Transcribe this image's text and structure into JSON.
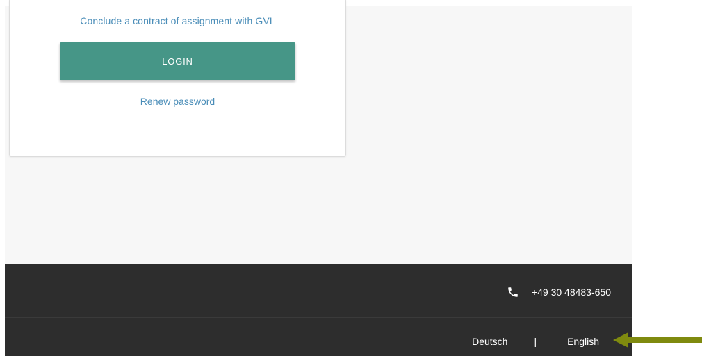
{
  "login": {
    "contract_link": "Conclude a contract of assignment with GVL",
    "login_button": "LOGIN",
    "renew_link": "Renew password"
  },
  "footer": {
    "phone_icon": "phone-icon",
    "phone": "+49 30 48483-650",
    "languages": {
      "german": "Deutsch",
      "separator": "|",
      "english": "English"
    }
  },
  "annotation": {
    "arrow_color": "#7f8a0f",
    "arrow_icon": "arrow-left-icon"
  },
  "colors": {
    "accent": "#469687",
    "link": "#4a8db8",
    "footer_bg": "#2d2d2d",
    "content_bg": "#f7f7f7"
  }
}
